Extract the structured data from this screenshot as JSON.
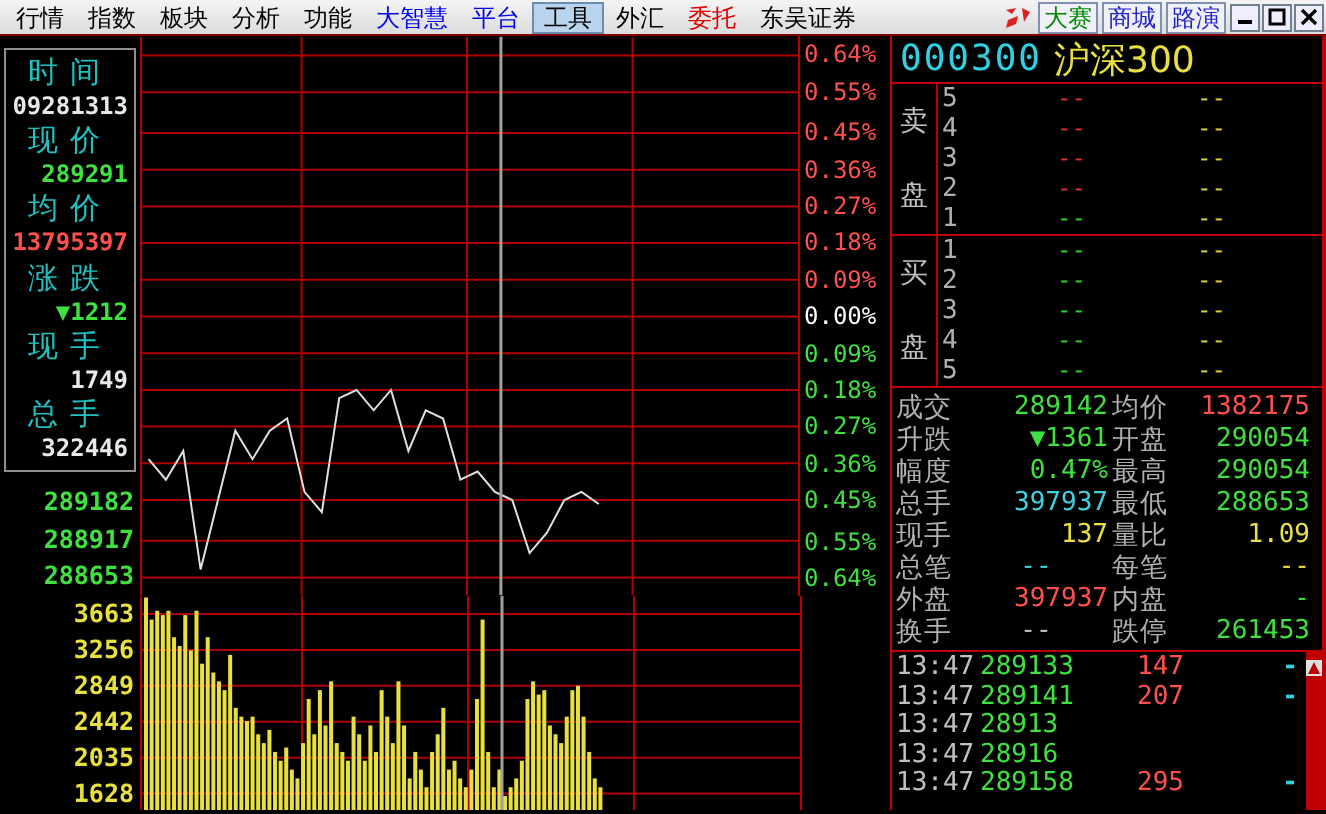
{
  "menu": [
    {
      "label": "行情",
      "selected": false,
      "color": "#000000"
    },
    {
      "label": "指数",
      "selected": false,
      "color": "#000000"
    },
    {
      "label": "板块",
      "selected": false,
      "color": "#000000"
    },
    {
      "label": "分析",
      "selected": false,
      "color": "#000000"
    },
    {
      "label": "功能",
      "selected": false,
      "color": "#000000"
    },
    {
      "label": "大智慧",
      "selected": false,
      "color": "#0000ee"
    },
    {
      "label": "平台",
      "selected": false,
      "color": "#0000ee"
    },
    {
      "label": "工具",
      "selected": true,
      "color": "#000000"
    },
    {
      "label": "外汇",
      "selected": false,
      "color": "#000000"
    },
    {
      "label": "委托",
      "selected": false,
      "color": "#e00000"
    },
    {
      "label": "东吴证券",
      "selected": false,
      "color": "#000000"
    }
  ],
  "menu_buttons": [
    {
      "label": "大赛",
      "color": "#008800"
    },
    {
      "label": "商城",
      "color": "#2020cc"
    },
    {
      "label": "路演",
      "color": "#2020cc"
    }
  ],
  "info_box": [
    {
      "label": "时间",
      "value": "09281313",
      "color": "#e8e8e8"
    },
    {
      "label": "现价",
      "value": "289291",
      "color": "#40e040"
    },
    {
      "label": "均价",
      "value": "13795397",
      "color": "#ff5050"
    },
    {
      "label": "涨跌",
      "value": "▼1212",
      "color": "#40e040"
    },
    {
      "label": "现手",
      "value": "1749",
      "color": "#e8e8e8"
    },
    {
      "label": "总手",
      "value": "322446",
      "color": "#e8e8e8"
    }
  ],
  "price_labels": [
    "289182",
    "288917",
    "288653"
  ],
  "price_chart": {
    "chart_data": {
      "type": "line",
      "ylim": [
        -0.64,
        0.64
      ],
      "grid": true,
      "categories": [
        null,
        null,
        null,
        null,
        null,
        null,
        null,
        null,
        null,
        null,
        null,
        null,
        null,
        null,
        null,
        null,
        null,
        null,
        null,
        null,
        null,
        null,
        null,
        null,
        null,
        null,
        null,
        null,
        null,
        null,
        null,
        null,
        null,
        null,
        null,
        null,
        null,
        null
      ],
      "series": [
        {
          "color": "#e0e0e0",
          "values": [
            -0.35,
            -0.4,
            -0.33,
            -0.62,
            -0.45,
            -0.28,
            -0.35,
            -0.28,
            -0.25,
            -0.43,
            -0.48,
            -0.2,
            -0.18,
            -0.23,
            -0.18,
            -0.33,
            -0.23,
            -0.25,
            -0.4,
            -0.38,
            -0.43,
            -0.45,
            -0.58,
            -0.53,
            -0.45,
            -0.43,
            -0.46,
            null,
            null,
            null,
            null,
            null,
            null,
            null,
            null,
            null,
            null,
            null
          ]
        }
      ],
      "yticks": [
        {
          "value": 0.64,
          "label": "0.64%"
        },
        {
          "value": 0.55,
          "label": "0.55%"
        },
        {
          "value": 0.45,
          "label": "0.45%"
        },
        {
          "value": 0.36,
          "label": "0.36%"
        },
        {
          "value": 0.27,
          "label": "0.27%"
        },
        {
          "value": 0.18,
          "label": "0.18%"
        },
        {
          "value": 0.09,
          "label": "0.09%"
        },
        {
          "value": 0,
          "label": "0.00%"
        },
        {
          "value": -0.09,
          "label": "0.09%"
        },
        {
          "value": -0.18,
          "label": "0.18%"
        },
        {
          "value": -0.27,
          "label": "0.27%"
        },
        {
          "value": -0.36,
          "label": "0.36%"
        },
        {
          "value": -0.45,
          "label": "0.45%"
        },
        {
          "value": -0.55,
          "label": "0.55%"
        },
        {
          "value": -0.64,
          "label": "0.64%"
        }
      ]
    }
  },
  "volume_labels": [
    "3663",
    "3256",
    "2849",
    "2442",
    "2035",
    "1628"
  ],
  "quote": {
    "code": "000300",
    "name": "沪深300"
  },
  "sell": {
    "label": [
      "卖",
      "盘"
    ],
    "levels": [
      {
        "level": "5",
        "price": "--",
        "volume": "--",
        "color": "#e03030"
      },
      {
        "level": "4",
        "price": "--",
        "volume": "--",
        "color": "#e03030"
      },
      {
        "level": "3",
        "price": "--",
        "volume": "--",
        "color": "#e03030"
      },
      {
        "level": "2",
        "price": "--",
        "volume": "--",
        "color": "#e03030"
      },
      {
        "level": "1",
        "price": "--",
        "volume": "--",
        "color": "#30d030"
      }
    ]
  },
  "buy": {
    "label": [
      "买",
      "盘"
    ],
    "levels": [
      {
        "level": "1",
        "price": "--",
        "volume": "--",
        "color": "#30d030"
      },
      {
        "level": "2",
        "price": "--",
        "volume": "--",
        "color": "#30d030"
      },
      {
        "level": "3",
        "price": "--",
        "volume": "--",
        "color": "#30d030"
      },
      {
        "level": "4",
        "price": "--",
        "volume": "--",
        "color": "#30d030"
      },
      {
        "level": "5",
        "price": "--",
        "volume": "--",
        "color": "#30d030"
      }
    ]
  },
  "stats": [
    {
      "label": "成交",
      "value": "289142",
      "color": "#40e040"
    },
    {
      "label": "均价",
      "value": "1382175",
      "color": "#ff5050"
    },
    {
      "label": "升跌",
      "value": "▼1361",
      "color": "#40e040"
    },
    {
      "label": "开盘",
      "value": "290054",
      "color": "#40e040"
    },
    {
      "label": "幅度",
      "value": "0.47%",
      "color": "#40e040"
    },
    {
      "label": "最高",
      "value": "290054",
      "color": "#40e040"
    },
    {
      "label": "总手",
      "value": "397937",
      "color": "#40d0e0"
    },
    {
      "label": "最低",
      "value": "288653",
      "color": "#40e040"
    },
    {
      "label": "现手",
      "value": "137",
      "color": "#e8e040"
    },
    {
      "label": "量比",
      "value": "1.09",
      "color": "#e8e040"
    },
    {
      "label": "总笔",
      "value": "--",
      "color": "#40d0e0"
    },
    {
      "label": "每笔",
      "value": "--",
      "color": "#e8e040"
    },
    {
      "label": "外盘",
      "value": "397937",
      "color": "#ff5050"
    },
    {
      "label": "内盘",
      "value": "-",
      "color": "#40e040"
    },
    {
      "label": "换手",
      "value": "--",
      "color": "#c0c0c0"
    },
    {
      "label": "跌停",
      "value": "261453",
      "color": "#40e040"
    }
  ],
  "ticks": [
    {
      "time": "13:47",
      "price": "289133",
      "volume": "147",
      "column_4": "-"
    },
    {
      "time": "13:47",
      "price": "289141",
      "volume": "207",
      "column_4": "-"
    },
    {
      "time": "13:47",
      "price": "28913"
    },
    {
      "time": "13:47",
      "price": "28916"
    },
    {
      "time": "13:47",
      "price": "289158",
      "volume": "295",
      "column_4": "-"
    }
  ]
}
